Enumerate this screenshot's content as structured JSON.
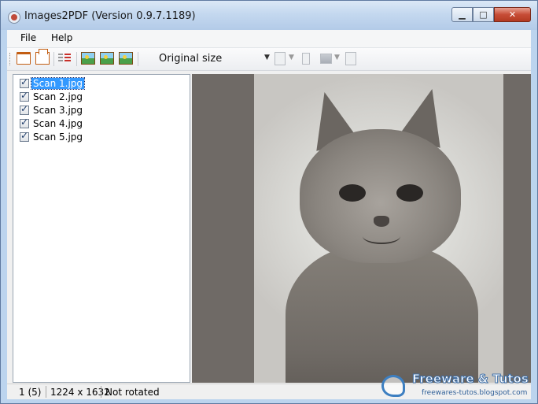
{
  "window": {
    "title": "Images2PDF (Version 0.9.7.1189)"
  },
  "menu": {
    "file": "File",
    "help": "Help"
  },
  "toolbar": {
    "size_select": "Original size"
  },
  "files": [
    {
      "label": "Scan 1.jpg",
      "checked": true,
      "selected": true
    },
    {
      "label": "Scan 2.jpg",
      "checked": true,
      "selected": false
    },
    {
      "label": "Scan 3.jpg",
      "checked": true,
      "selected": false
    },
    {
      "label": "Scan 4.jpg",
      "checked": true,
      "selected": false
    },
    {
      "label": "Scan 5.jpg",
      "checked": true,
      "selected": false
    }
  ],
  "status": {
    "page": "1 (5)",
    "dimensions": "1224 x 1632",
    "rotation": "Not rotated"
  },
  "watermark": {
    "title": "Freeware & Tutos",
    "url": "freewares-tutos.blogspot.com"
  }
}
